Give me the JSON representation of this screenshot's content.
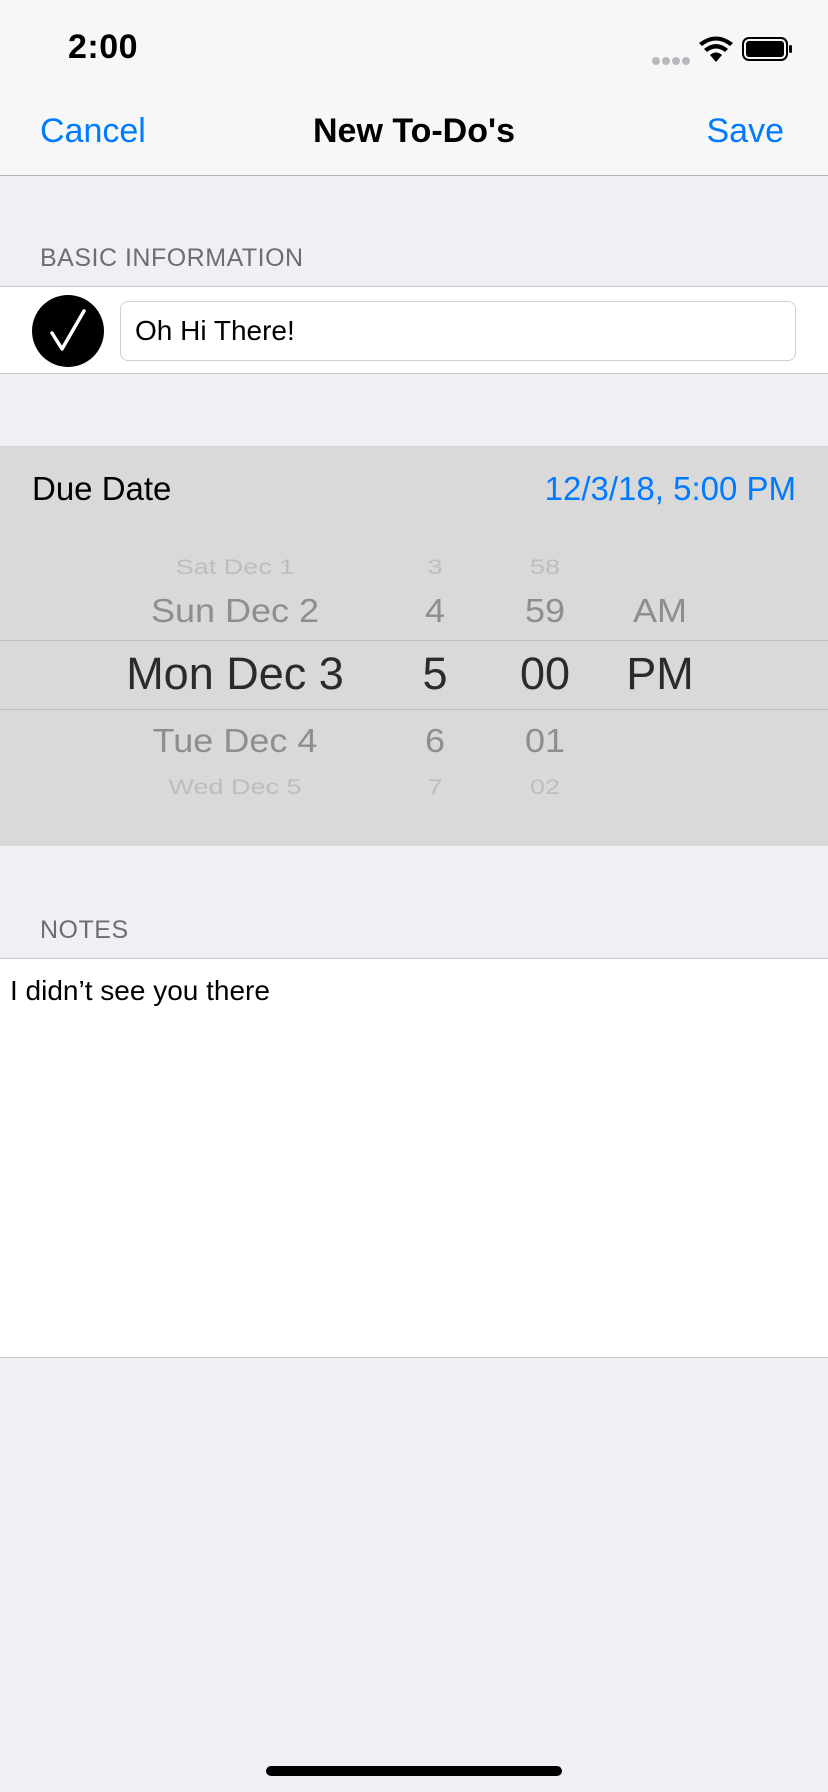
{
  "status": {
    "time": "2:00"
  },
  "nav": {
    "cancel": "Cancel",
    "title": "New To-Do's",
    "save": "Save"
  },
  "basic": {
    "header": "BASIC INFORMATION",
    "title_value": "Oh Hi There!"
  },
  "due": {
    "label": "Due Date",
    "value": "12/3/18, 5:00 PM",
    "picker": {
      "dates": [
        "Sat Dec 1",
        "Sun Dec 2",
        "Mon Dec 3",
        "Tue Dec 4",
        "Wed Dec 5"
      ],
      "hours": [
        "3",
        "4",
        "5",
        "6",
        "7"
      ],
      "minutes": [
        "58",
        "59",
        "00",
        "01",
        "02"
      ],
      "ampm": [
        "AM",
        "PM"
      ],
      "selected_index": 2
    }
  },
  "notes": {
    "header": "NOTES",
    "text": "I didn’t see you there"
  },
  "colors": {
    "accent": "#007aff",
    "background": "#efeff4",
    "picker_bg": "#d9d9d9"
  }
}
